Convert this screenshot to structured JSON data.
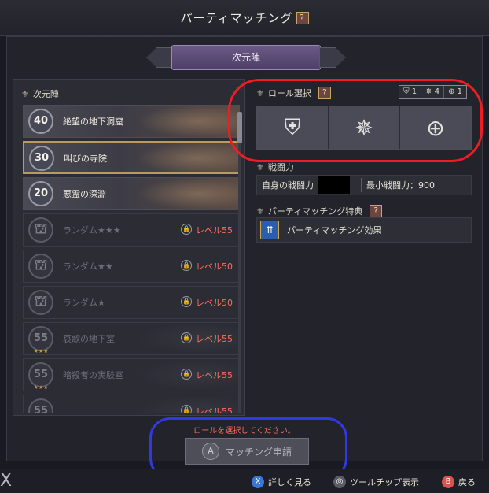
{
  "header": {
    "title": "パーティマッチング",
    "help": "?"
  },
  "tab": {
    "label": "次元陣"
  },
  "left": {
    "heading": "次元陣",
    "rows": [
      {
        "level_badge": "40",
        "name": "絶望の地下洞窟",
        "lock": "",
        "level_req": "",
        "stars": ""
      },
      {
        "level_badge": "30",
        "name": "叫びの寺院",
        "lock": "",
        "level_req": "",
        "stars": ""
      },
      {
        "level_badge": "20",
        "name": "悪霊の深淵",
        "lock": "",
        "level_req": "",
        "stars": ""
      },
      {
        "level_badge": "",
        "name": "ランダム★★★",
        "lock": "🔒",
        "level_req": "レベル55",
        "stars": ""
      },
      {
        "level_badge": "",
        "name": "ランダム★★",
        "lock": "🔒",
        "level_req": "レベル50",
        "stars": ""
      },
      {
        "level_badge": "",
        "name": "ランダム★",
        "lock": "🔒",
        "level_req": "レベル50",
        "stars": ""
      },
      {
        "level_badge": "55",
        "name": "哀歌の地下室",
        "lock": "🔒",
        "level_req": "レベル55",
        "stars": "★★★"
      },
      {
        "level_badge": "55",
        "name": "暗殺者の実験室",
        "lock": "🔒",
        "level_req": "レベル55",
        "stars": "★★★"
      },
      {
        "level_badge": "55",
        "name": "",
        "lock": "🔒",
        "level_req": "レベル55",
        "stars": ""
      }
    ]
  },
  "right": {
    "role_heading": "ロール選択",
    "counts": [
      "1",
      "4",
      "1"
    ],
    "roles": [
      "tank-role-icon",
      "dps-role-icon",
      "healer-role-icon"
    ],
    "power_heading": "戦闘力",
    "own_power_label": "自身の戦闘力",
    "min_power": "最小戦闘力：900",
    "bonus_heading": "パーティマッチング特典",
    "bonus_item": "パーティマッチング効果"
  },
  "bottom": {
    "warning": "ロールを選択してください。",
    "apply_label": "マッチング申請",
    "apply_key": "A"
  },
  "footer": {
    "left_glyph": "X",
    "hints": [
      {
        "key": "X",
        "label": "詳しく見る",
        "color": "#3a78d6"
      },
      {
        "key": "◎",
        "label": "ツールチップ表示",
        "color": "#5a5b66"
      },
      {
        "key": "B",
        "label": "戻る",
        "color": "#d9534f"
      }
    ]
  },
  "colors": {
    "accent_gold": "#b79c5f",
    "warning_red": "#ff6a5c",
    "annotation_red": "#ef1d23",
    "annotation_blue": "#3339e0"
  }
}
